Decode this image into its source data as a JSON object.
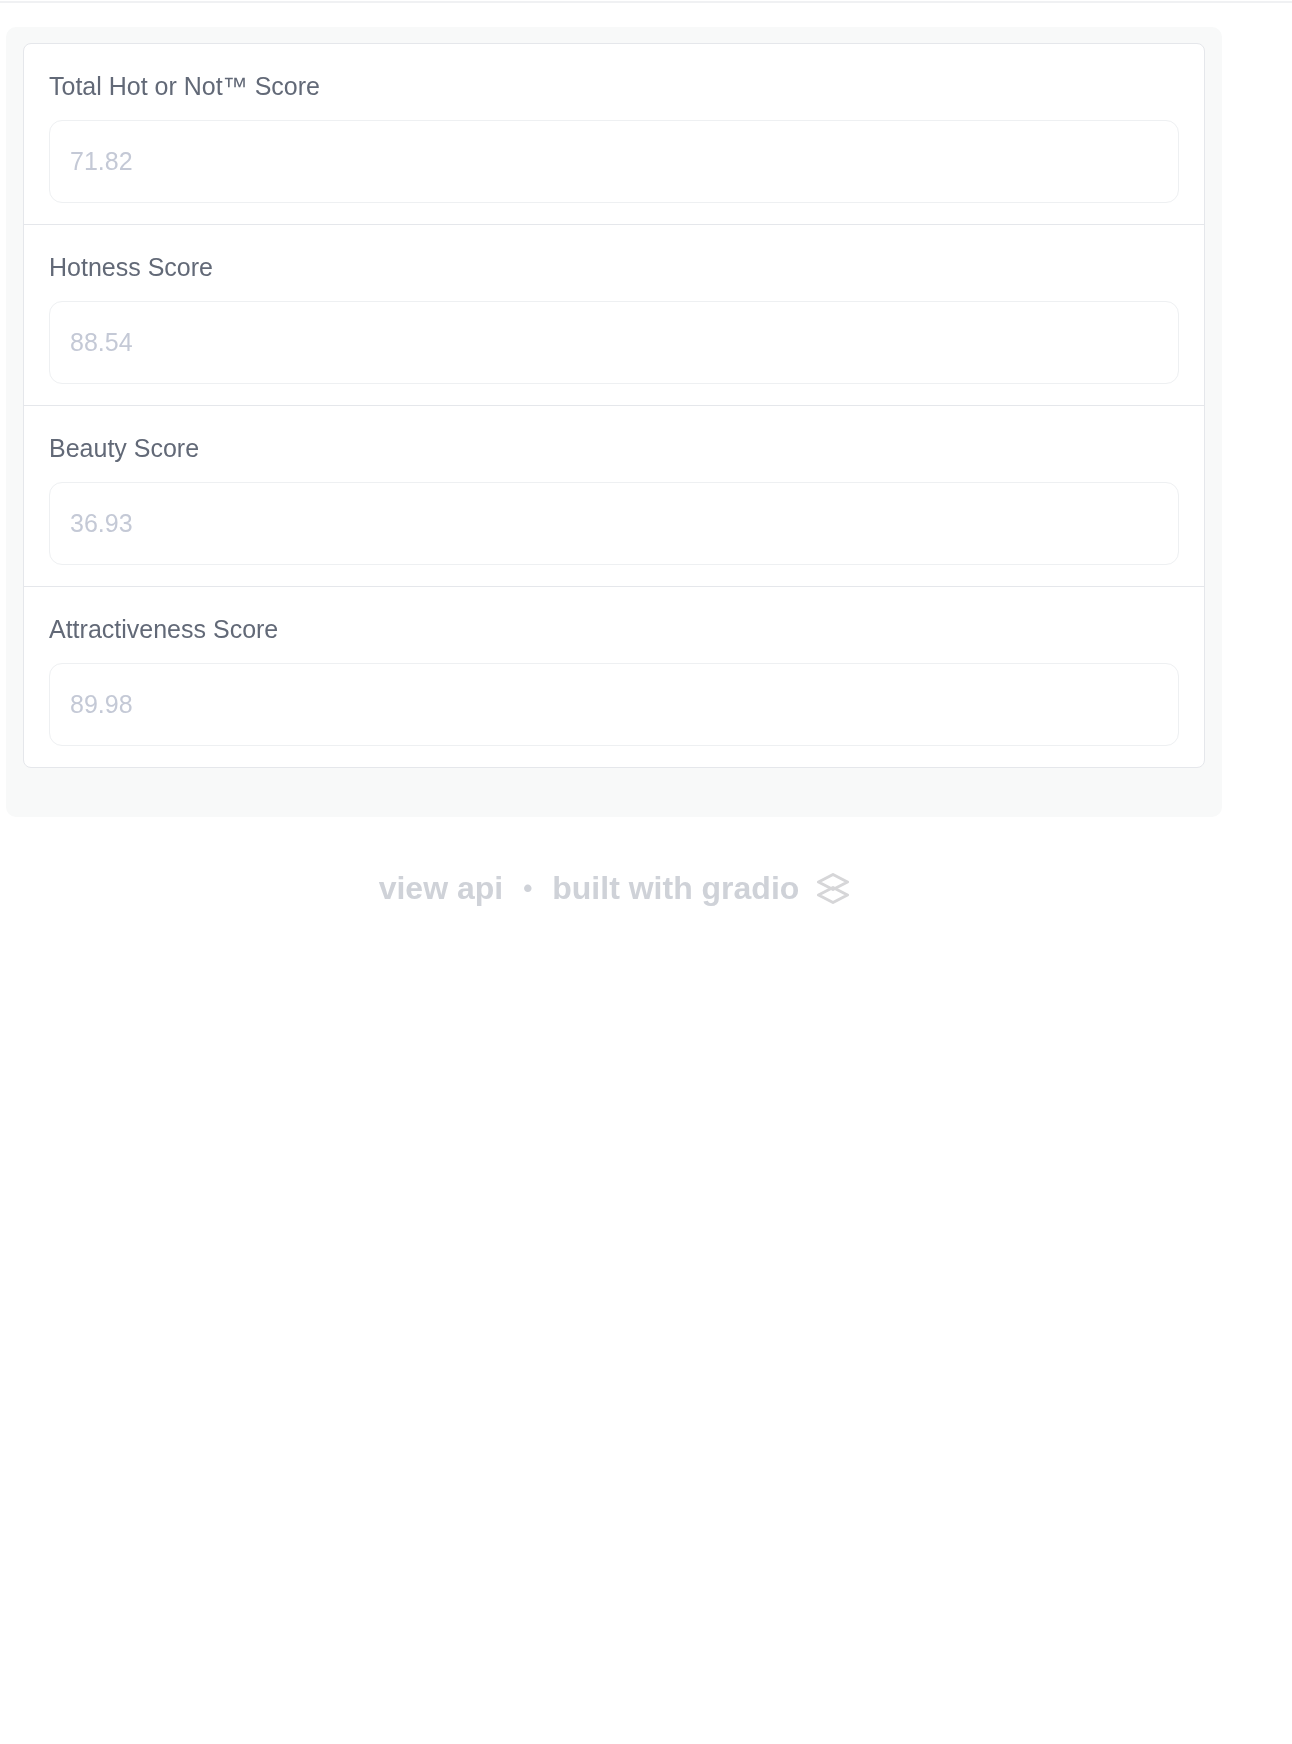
{
  "fields": [
    {
      "label": "Total Hot or Not™ Score",
      "value": "71.82",
      "disabled": true
    },
    {
      "label": "Hotness Score",
      "value": "88.54",
      "disabled": true
    },
    {
      "label": "Beauty Score",
      "value": "36.93",
      "disabled": true
    },
    {
      "label": "Attractiveness Score",
      "value": "89.98",
      "disabled": true
    }
  ],
  "footer": {
    "api_link": "view api",
    "separator": "•",
    "built_with_link": "built with gradio"
  }
}
